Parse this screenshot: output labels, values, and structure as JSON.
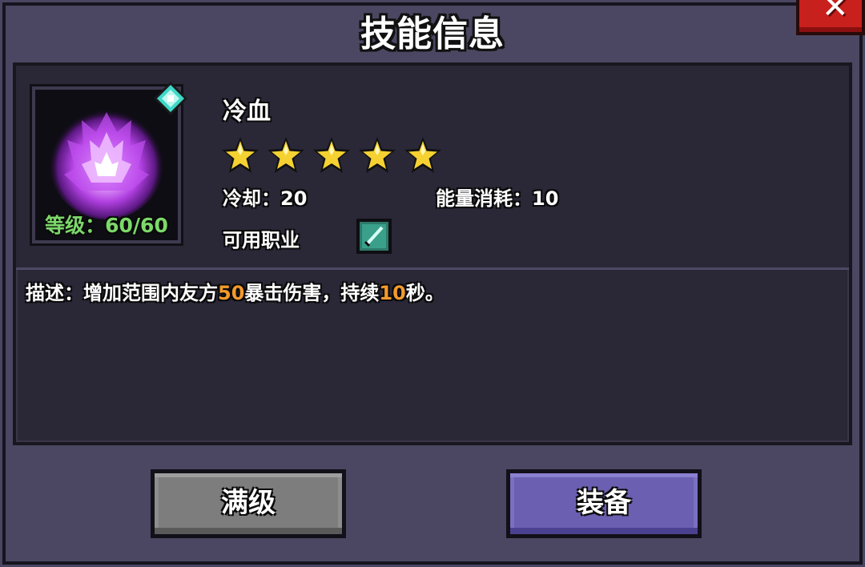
{
  "dialog": {
    "title": "技能信息",
    "close_icon": "close-x-icon"
  },
  "skill": {
    "icon": "purple-flame-icon",
    "gem_icon": "cyan-gem-icon",
    "level_text": "等级：60/60",
    "level_current": 60,
    "level_max": 60,
    "name": "冷血",
    "stars": 5,
    "stars_max": 5,
    "cooldown_text": "冷却：20",
    "energy_text": "能量消耗：10",
    "class_label": "可用职业",
    "class_icon": "sword-class-icon"
  },
  "description": {
    "prefix": "描述：增加范围内友方",
    "value1": "50",
    "middle": "暴击伤害，持续",
    "value2": "10",
    "suffix": "秒。"
  },
  "buttons": {
    "max_level": "满级",
    "equip": "装备"
  },
  "colors": {
    "highlight": "#f39a2c",
    "level_green": "#7cd96a",
    "equip_button": "#6a5fb0",
    "max_button": "#7d7d7d",
    "close_red": "#c8201c"
  }
}
